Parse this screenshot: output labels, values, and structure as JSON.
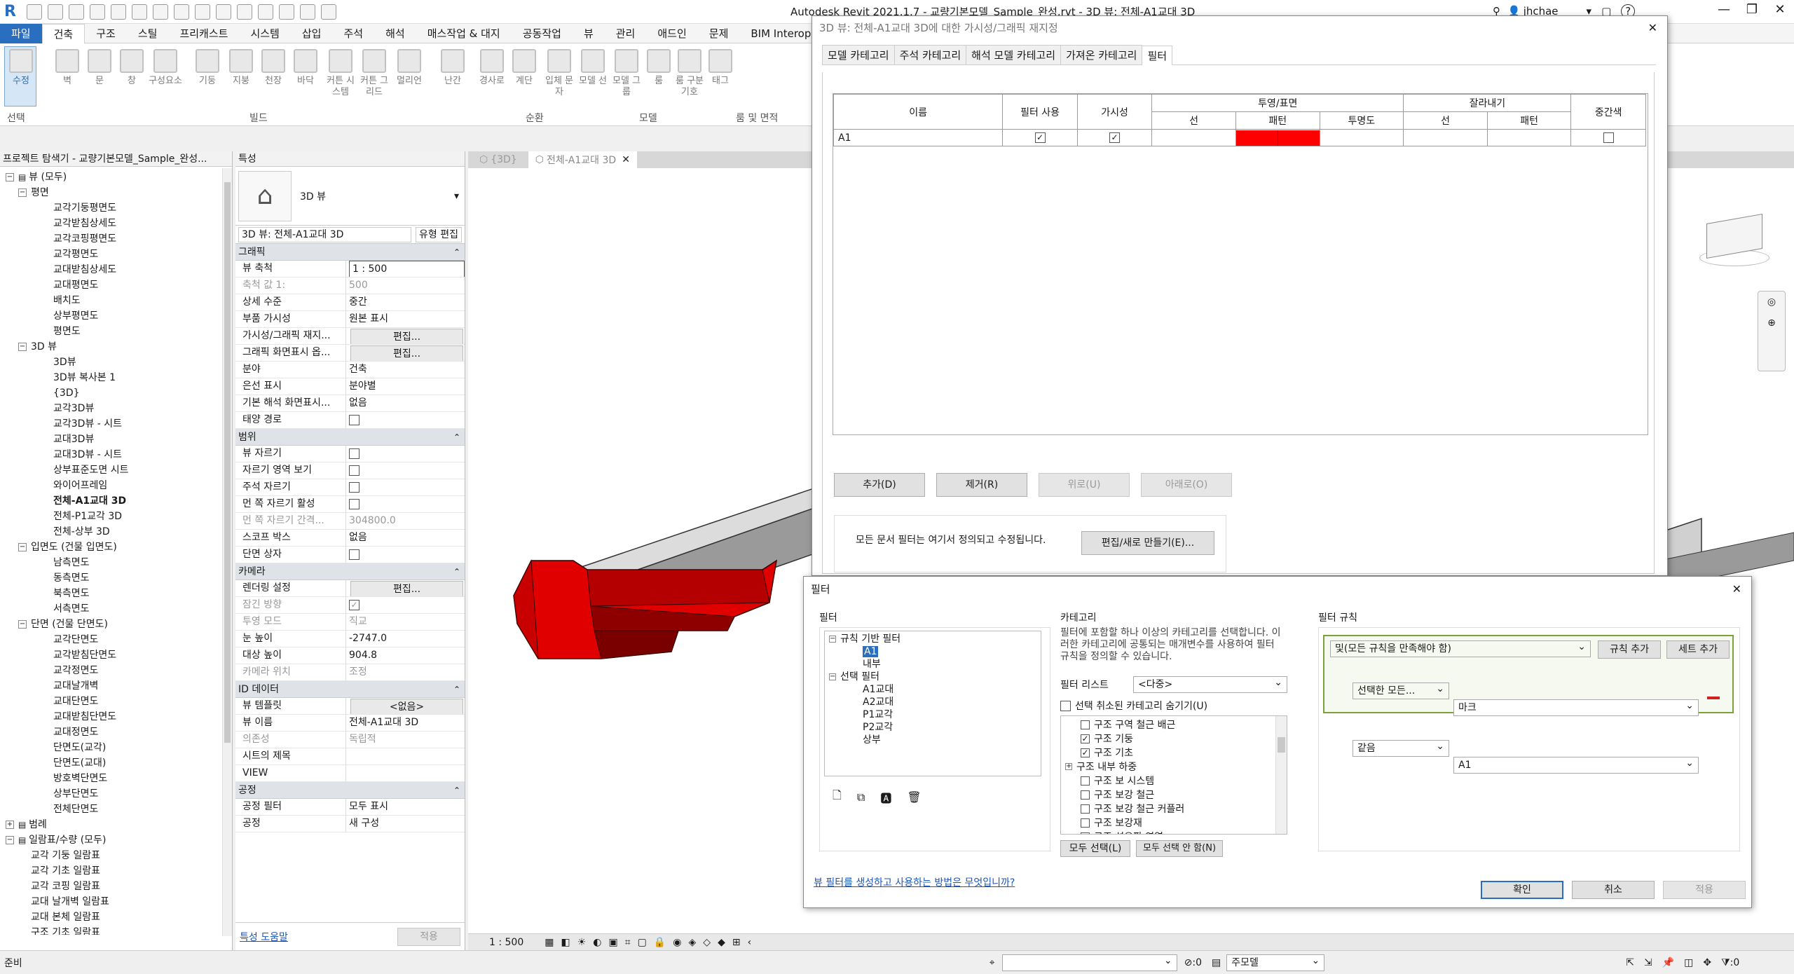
{
  "title_bar": {
    "text": "Autodesk Revit 2021.1.7 - 교량기본모델_Sample_완성.rvt - 3D 뷰: 전체-A1교대 3D",
    "user": "jhchae",
    "help": "?"
  },
  "ribbon_tabs": [
    "파일",
    "건축",
    "구조",
    "스틸",
    "프리캐스트",
    "시스템",
    "삽입",
    "주석",
    "해석",
    "매스작업 & 대지",
    "공동작업",
    "뷰",
    "관리",
    "애드인",
    "문제",
    "BIM Interoperability To"
  ],
  "ribbon": {
    "tools": [
      "수정",
      "벽",
      "문",
      "창",
      "구성요소",
      "기둥",
      "지붕",
      "천장",
      "바닥",
      "커튼 시스템",
      "커튼 그리드",
      "멀리언",
      "난간",
      "경사로",
      "계단",
      "입체 문자",
      "모델 선",
      "모델 그룹",
      "룸",
      "룸 구분 기호",
      "태그"
    ],
    "groups": [
      "선택",
      "빌드",
      "순환",
      "모델",
      "룸 및 면적"
    ]
  },
  "browser": {
    "title": "프로젝트 탐색기 - 교량기본모델_Sample_완성...",
    "items": [
      {
        "t": "뷰 (모두)",
        "lvl": 0,
        "tw": "−"
      },
      {
        "t": "평면",
        "lvl": 1,
        "tw": "−"
      },
      {
        "t": "교각기둥평면도",
        "lvl": 2
      },
      {
        "t": "교각받침상세도",
        "lvl": 2
      },
      {
        "t": "교각코핑평면도",
        "lvl": 2
      },
      {
        "t": "교각평면도",
        "lvl": 2
      },
      {
        "t": "교대받침상세도",
        "lvl": 2
      },
      {
        "t": "교대평면도",
        "lvl": 2
      },
      {
        "t": "배치도",
        "lvl": 2
      },
      {
        "t": "상부평면도",
        "lvl": 2
      },
      {
        "t": "평면도",
        "lvl": 2
      },
      {
        "t": "3D 뷰",
        "lvl": 1,
        "tw": "−"
      },
      {
        "t": "3D뷰",
        "lvl": 2
      },
      {
        "t": "3D뷰 복사본 1",
        "lvl": 2
      },
      {
        "t": "{3D}",
        "lvl": 2
      },
      {
        "t": "교각3D뷰",
        "lvl": 2
      },
      {
        "t": "교각3D뷰 - 시트",
        "lvl": 2
      },
      {
        "t": "교대3D뷰",
        "lvl": 2
      },
      {
        "t": "교대3D뷰 - 시트",
        "lvl": 2
      },
      {
        "t": "상부표준도면 시트",
        "lvl": 2
      },
      {
        "t": "와이어프레임",
        "lvl": 2
      },
      {
        "t": "전체-A1교대 3D",
        "lvl": 2,
        "bold": true
      },
      {
        "t": "전체-P1교각 3D",
        "lvl": 2
      },
      {
        "t": "전체-상부 3D",
        "lvl": 2
      },
      {
        "t": "입면도 (건물 입면도)",
        "lvl": 1,
        "tw": "−"
      },
      {
        "t": "남측면도",
        "lvl": 2
      },
      {
        "t": "동측면도",
        "lvl": 2
      },
      {
        "t": "북측면도",
        "lvl": 2
      },
      {
        "t": "서측면도",
        "lvl": 2
      },
      {
        "t": "단면 (건물 단면도)",
        "lvl": 1,
        "tw": "−"
      },
      {
        "t": "교각단면도",
        "lvl": 2
      },
      {
        "t": "교각받침단면도",
        "lvl": 2
      },
      {
        "t": "교각정면도",
        "lvl": 2
      },
      {
        "t": "교대날개벽",
        "lvl": 2
      },
      {
        "t": "교대단면도",
        "lvl": 2
      },
      {
        "t": "교대받침단면도",
        "lvl": 2
      },
      {
        "t": "교대정면도",
        "lvl": 2
      },
      {
        "t": "단면도(교각)",
        "lvl": 2
      },
      {
        "t": "단면도(교대)",
        "lvl": 2
      },
      {
        "t": "방호벽단면도",
        "lvl": 2
      },
      {
        "t": "상부단면도",
        "lvl": 2
      },
      {
        "t": "전체단면도",
        "lvl": 2
      },
      {
        "t": "범례",
        "lvl": 0,
        "tw": "+"
      },
      {
        "t": "일람표/수량 (모두)",
        "lvl": 0,
        "tw": "−"
      },
      {
        "t": "교각 기둥 일람표",
        "lvl": 1
      },
      {
        "t": "교각 기초 일람표",
        "lvl": 1
      },
      {
        "t": "교각 코핑 일람표",
        "lvl": 1
      },
      {
        "t": "교대 날개벽 일람표",
        "lvl": 1
      },
      {
        "t": "교대 본체 일람표",
        "lvl": 1
      },
      {
        "t": "구조 기초 일람표",
        "lvl": 1
      }
    ]
  },
  "props": {
    "title": "특성",
    "type_label": "3D 뷰",
    "view_selector": "3D 뷰: 전체-A1교대 3D",
    "edit_type": "유형 편집",
    "help_link": "특성 도움말",
    "apply": "적용",
    "rows": [
      {
        "sec": "그래픽"
      },
      {
        "k": "뷰 축척",
        "v": "1 : 500",
        "box": true
      },
      {
        "k": "축척 값    1:",
        "v": "500",
        "dim": true
      },
      {
        "k": "상세 수준",
        "v": "중간"
      },
      {
        "k": "부품 가시성",
        "v": "원본 표시"
      },
      {
        "k": "가시성/그래픽 재지...",
        "v": "편집...",
        "btn": true
      },
      {
        "k": "그래픽 화면표시 옵...",
        "v": "편집...",
        "btn": true
      },
      {
        "k": "분야",
        "v": "건축"
      },
      {
        "k": "은선 표시",
        "v": "분야별"
      },
      {
        "k": "기본 해석 화면표시...",
        "v": "없음"
      },
      {
        "k": "태양 경로",
        "cb": ""
      },
      {
        "sec": "범위"
      },
      {
        "k": "뷰 자르기",
        "cb": ""
      },
      {
        "k": "자르기 영역 보기",
        "cb": ""
      },
      {
        "k": "주석 자르기",
        "cb": ""
      },
      {
        "k": "먼 쪽 자르기 활성",
        "cb": ""
      },
      {
        "k": "먼 쪽 자르기 간격...",
        "v": "304800.0",
        "dim": true
      },
      {
        "k": "스코프 박스",
        "v": "없음"
      },
      {
        "k": "단면 상자",
        "cb": ""
      },
      {
        "sec": "카메라"
      },
      {
        "k": "렌더링 설정",
        "v": "편집...",
        "btn": true
      },
      {
        "k": "잠긴 방향",
        "cb": "✓",
        "dim": true
      },
      {
        "k": "투영 모드",
        "v": "직교",
        "dim": true
      },
      {
        "k": "눈 높이",
        "v": "-2747.0"
      },
      {
        "k": "대상 높이",
        "v": "904.8"
      },
      {
        "k": "카메라 위치",
        "v": "조정",
        "dim": true
      },
      {
        "sec": "ID 데이터"
      },
      {
        "k": "뷰 템플릿",
        "v": "<없음>",
        "btn": true
      },
      {
        "k": "뷰 이름",
        "v": "전체-A1교대 3D"
      },
      {
        "k": "의존성",
        "v": "독립적",
        "dim": true
      },
      {
        "k": "시트의 제목",
        "v": ""
      },
      {
        "k": "VIEW",
        "v": ""
      },
      {
        "sec": "공정"
      },
      {
        "k": "공정 필터",
        "v": "모두 표시"
      },
      {
        "k": "공정",
        "v": "새 구성"
      }
    ]
  },
  "view_tabs": [
    {
      "label": "{3D}",
      "active": false
    },
    {
      "label": "전체-A1교대 3D",
      "active": true
    }
  ],
  "view_scale": "1 : 500",
  "status": {
    "left": "준비",
    "zero": ":0",
    "model": "주모델",
    "filter": ":0"
  },
  "vg_dialog": {
    "title": "3D 뷰: 전체-A1교대 3D에 대한 가시성/그래픽 재지정",
    "tabs": [
      "모델 카테고리",
      "주석 카테고리",
      "해석 모델 카테고리",
      "가져온 카테고리",
      "필터"
    ],
    "active_tab": 4,
    "headers": {
      "name": "이름",
      "use": "필터 사용",
      "vis": "가시성",
      "proj": "투영/표면",
      "line": "선",
      "pattern": "패턴",
      "trans": "투명도",
      "cut": "잘라내기",
      "cut_line": "선",
      "cut_pattern": "패턴",
      "halftone": "중간색"
    },
    "row": {
      "name": "A1",
      "use": true,
      "vis": true,
      "halftone": false
    },
    "pattern_color": "#ff0000",
    "buttons": {
      "add": "추가(D)",
      "remove": "제거(R)",
      "up": "위로(U)",
      "down": "아래로(O)"
    },
    "info": "모든 문서 필터는 여기서 정의되고 수정됩니다.",
    "edit_new": "편집/새로 만들기(E)..."
  },
  "filter_dialog": {
    "title": "필터",
    "filters_label": "필터",
    "tree": [
      {
        "t": "규칙 기반 필터",
        "lvl": 0,
        "tw": "−"
      },
      {
        "t": "A1",
        "lvl": 1,
        "sel": true
      },
      {
        "t": "내부",
        "lvl": 1
      },
      {
        "t": "선택 필터",
        "lvl": 0,
        "tw": "−"
      },
      {
        "t": "A1교대",
        "lvl": 1
      },
      {
        "t": "A2교대",
        "lvl": 1
      },
      {
        "t": "P1교각",
        "lvl": 1
      },
      {
        "t": "P2교각",
        "lvl": 1
      },
      {
        "t": "상부",
        "lvl": 1
      }
    ],
    "category_label": "카테고리",
    "category_desc": "필터에 포함할 하나 이상의 카테고리를 선택합니다. 이러한 카테고리에 공통되는 매개변수를 사용하여 필터 규칙을 정의할 수 있습니다.",
    "filter_list_label": "필터 리스트",
    "filter_list_value": "<다중>",
    "hide_unchecked": "선택 취소된 카테고리 숨기기(U)",
    "categories": [
      {
        "t": "구조 구역 철근 배근",
        "c": false
      },
      {
        "t": "구조 기둥",
        "c": true
      },
      {
        "t": "구조 기초",
        "c": true
      },
      {
        "t": "구조 내부 하중",
        "c": false,
        "exp": true
      },
      {
        "t": "구조 보 시스템",
        "c": false
      },
      {
        "t": "구조 보강 철근",
        "c": false
      },
      {
        "t": "구조 보강 철근 커플러",
        "c": false
      },
      {
        "t": "구조 보강재",
        "c": false
      },
      {
        "t": "구조 섬유판 영역",
        "c": false
      }
    ],
    "select_all": "모두 선택(L)",
    "select_none": "모두 선택 안 함(N)",
    "rules_label": "필터 규칙",
    "rule_logic": "및(모든 규칙을 만족해야 함)",
    "add_rule": "규칙 추가",
    "add_set": "세트 추가",
    "rule_param_1": "선택한 모든...",
    "rule_param_2": "마크",
    "rule_op": "같음",
    "rule_value": "A1",
    "help_link": "뷰 필터를 생성하고 사용하는 방법은 무엇입니까?",
    "ok": "확인",
    "cancel": "취소",
    "apply": "적용"
  },
  "colors": {
    "accent": "#2a6fbf",
    "filter_red": "#ff0000"
  }
}
